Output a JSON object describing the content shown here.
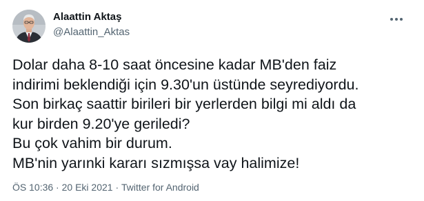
{
  "author": {
    "name": "Alaattin Aktaş",
    "handle": "@Alaattin_Aktas",
    "avatar_icon": "profile-photo-icon"
  },
  "more_icon": "more-options-icon",
  "tweet": {
    "lines": [
      "Dolar daha 8-10 saat öncesine kadar MB'den faiz",
      "indirimi beklendiği için 9.30'un üstünde seyrediyordu.",
      "Son birkaç saattir birileri bir yerlerden bilgi mi aldı da",
      "kur birden 9.20'ye geriledi?",
      "Bu çok vahim bir durum.",
      "MB'nin yarınki kararı sızmışsa vay halimize!"
    ]
  },
  "meta": {
    "time": "ÖS 10:36",
    "sep1": "·",
    "date": "20 Eki 2021",
    "sep2": "·",
    "source": "Twitter for Android"
  },
  "colors": {
    "text": "#0f1419",
    "secondary": "#536471"
  }
}
